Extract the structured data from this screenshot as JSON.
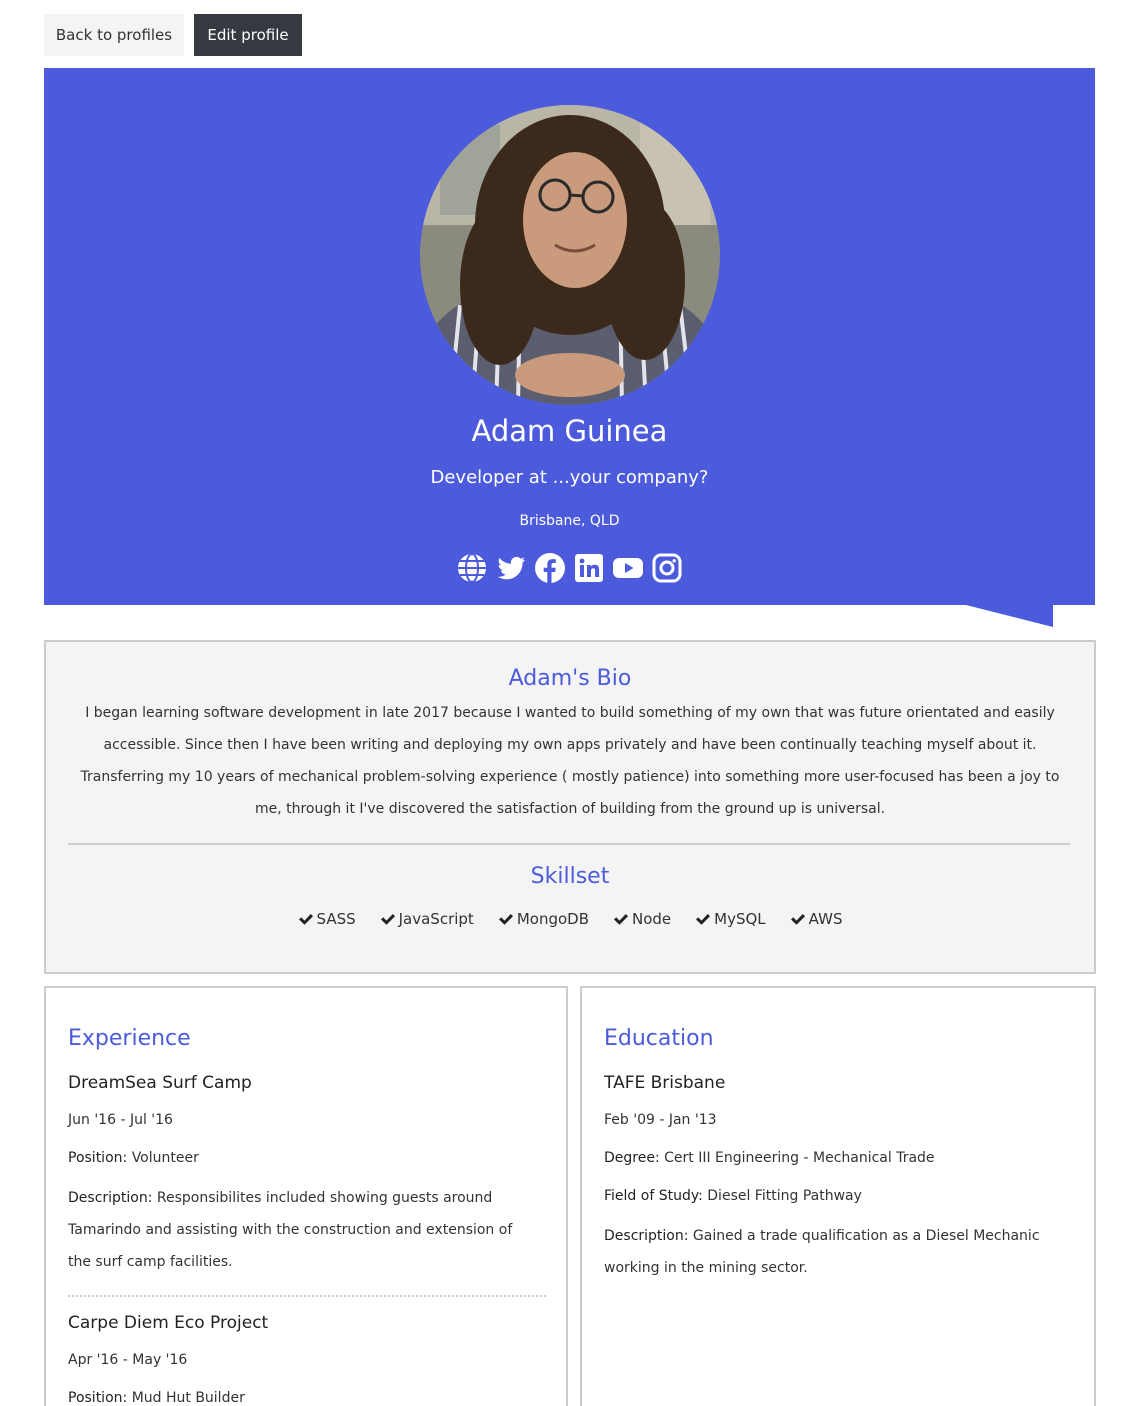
{
  "toolbar": {
    "back_label": "Back to profiles",
    "edit_label": "Edit profile"
  },
  "profile": {
    "name": "Adam Guinea",
    "status": "Developer at ...your company?",
    "location": "Brisbane, QLD",
    "social": [
      "globe-icon",
      "twitter-icon",
      "facebook-icon",
      "linkedin-icon",
      "youtube-icon",
      "instagram-icon"
    ]
  },
  "bio": {
    "title": "Adam's Bio",
    "text": "I began learning software development in late 2017 because I wanted to build something of my own that was future orientated and easily accessible. Since then I have been writing and deploying my own apps privately and have been continually teaching myself about it. Transferring my 10 years of mechanical problem-solving experience ( mostly patience) into something more user-focused has been a joy to me, through it I've discovered the satisfaction of building from the ground up is universal."
  },
  "skillset": {
    "title": "Skillset",
    "items": [
      "SASS",
      "JavaScript",
      "MongoDB",
      "Node",
      "MySQL",
      "AWS"
    ]
  },
  "experience": {
    "title": "Experience",
    "items": [
      {
        "company": "DreamSea Surf Camp",
        "dates": "Jun '16 - Jul '16",
        "position_label": "Position:",
        "position": "Volunteer",
        "description_label": "Description:",
        "description": "Responsibilites included showing guests around Tamarindo and assisting with the construction and extension of the surf camp facilities."
      },
      {
        "company": "Carpe Diem Eco Project",
        "dates": "Apr '16 - May '16",
        "position_label": "Position:",
        "position": "Mud Hut Builder"
      }
    ]
  },
  "education": {
    "title": "Education",
    "items": [
      {
        "school": "TAFE Brisbane",
        "dates": "Feb '09 - Jan '13",
        "degree_label": "Degree:",
        "degree": "Cert III Engineering - Mechanical Trade",
        "field_label": "Field of Study:",
        "field": "Diesel Fitting Pathway",
        "description_label": "Description:",
        "description": "Gained a trade qualification as a Diesel Mechanic working in the mining sector."
      }
    ]
  },
  "colors": {
    "primary": "#4b5bdc",
    "dark": "#343a40",
    "light": "#f4f4f4",
    "border": "#cccccc"
  }
}
